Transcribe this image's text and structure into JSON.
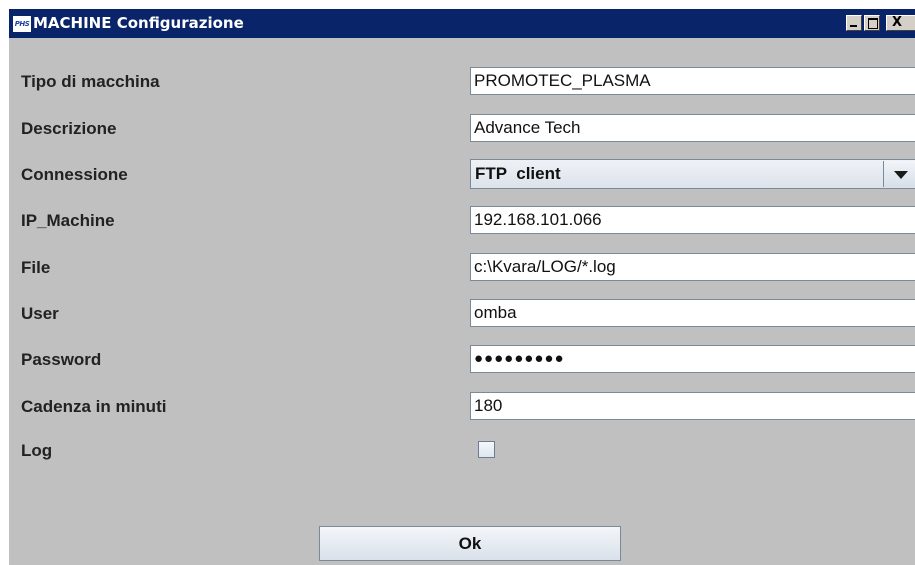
{
  "window": {
    "title": "MACHINE Configurazione",
    "app_icon_text": "PHS",
    "close_glyph": "X"
  },
  "form": {
    "fields": [
      {
        "label": "Tipo di macchina",
        "value": "PROMOTEC_PLASMA"
      },
      {
        "label": "Descrizione",
        "value": "Advance Tech"
      },
      {
        "label": "Connessione",
        "value": "FTP  client"
      },
      {
        "label": "IP_Machine",
        "value": "192.168.101.066"
      },
      {
        "label": "File",
        "value": "c:\\Kvara/LOG/*.log"
      },
      {
        "label": "User",
        "value": "omba"
      },
      {
        "label": "Password",
        "value": "●●●●●●●●●"
      },
      {
        "label": "Cadenza in minuti",
        "value": "180"
      },
      {
        "label": "Log"
      }
    ],
    "log_checked": false
  },
  "buttons": {
    "ok_label": "Ok"
  }
}
